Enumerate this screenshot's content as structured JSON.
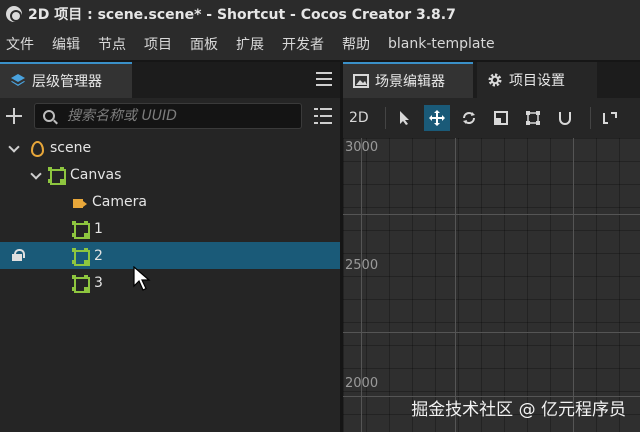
{
  "window": {
    "title": "2D 项目 : scene.scene* - Shortcut - Cocos Creator 3.8.7"
  },
  "menu": {
    "items": [
      "文件",
      "编辑",
      "节点",
      "项目",
      "面板",
      "扩展",
      "开发者",
      "帮助",
      "blank-template"
    ]
  },
  "hierarchy": {
    "tab_label": "层级管理器",
    "search_placeholder": "搜索名称或 UUID",
    "nodes": [
      {
        "label": "scene",
        "icon": "scene-icon",
        "depth": 0,
        "expanded": true
      },
      {
        "label": "Canvas",
        "icon": "node-icon",
        "depth": 1,
        "expanded": true
      },
      {
        "label": "Camera",
        "icon": "camera-icon",
        "depth": 2
      },
      {
        "label": "1",
        "icon": "node-icon",
        "depth": 2
      },
      {
        "label": "2",
        "icon": "node-icon",
        "depth": 2,
        "selected": true,
        "locked": true
      },
      {
        "label": "3",
        "icon": "node-icon",
        "depth": 2
      }
    ]
  },
  "scene_panel": {
    "tabs": [
      {
        "label": "场景编辑器",
        "active": true
      },
      {
        "label": "项目设置",
        "active": false
      }
    ],
    "tool_2d": "2D",
    "axis_labels": {
      "top": "3000",
      "mid": "2500",
      "bottom": "2000"
    }
  },
  "watermark": "掘金技术社区 @ 亿元程序员",
  "colors": {
    "accent": "#3a90c8",
    "selection": "#1a5a78",
    "node_icon": "#8ec63f",
    "camera_icon": "#e8a73a"
  }
}
